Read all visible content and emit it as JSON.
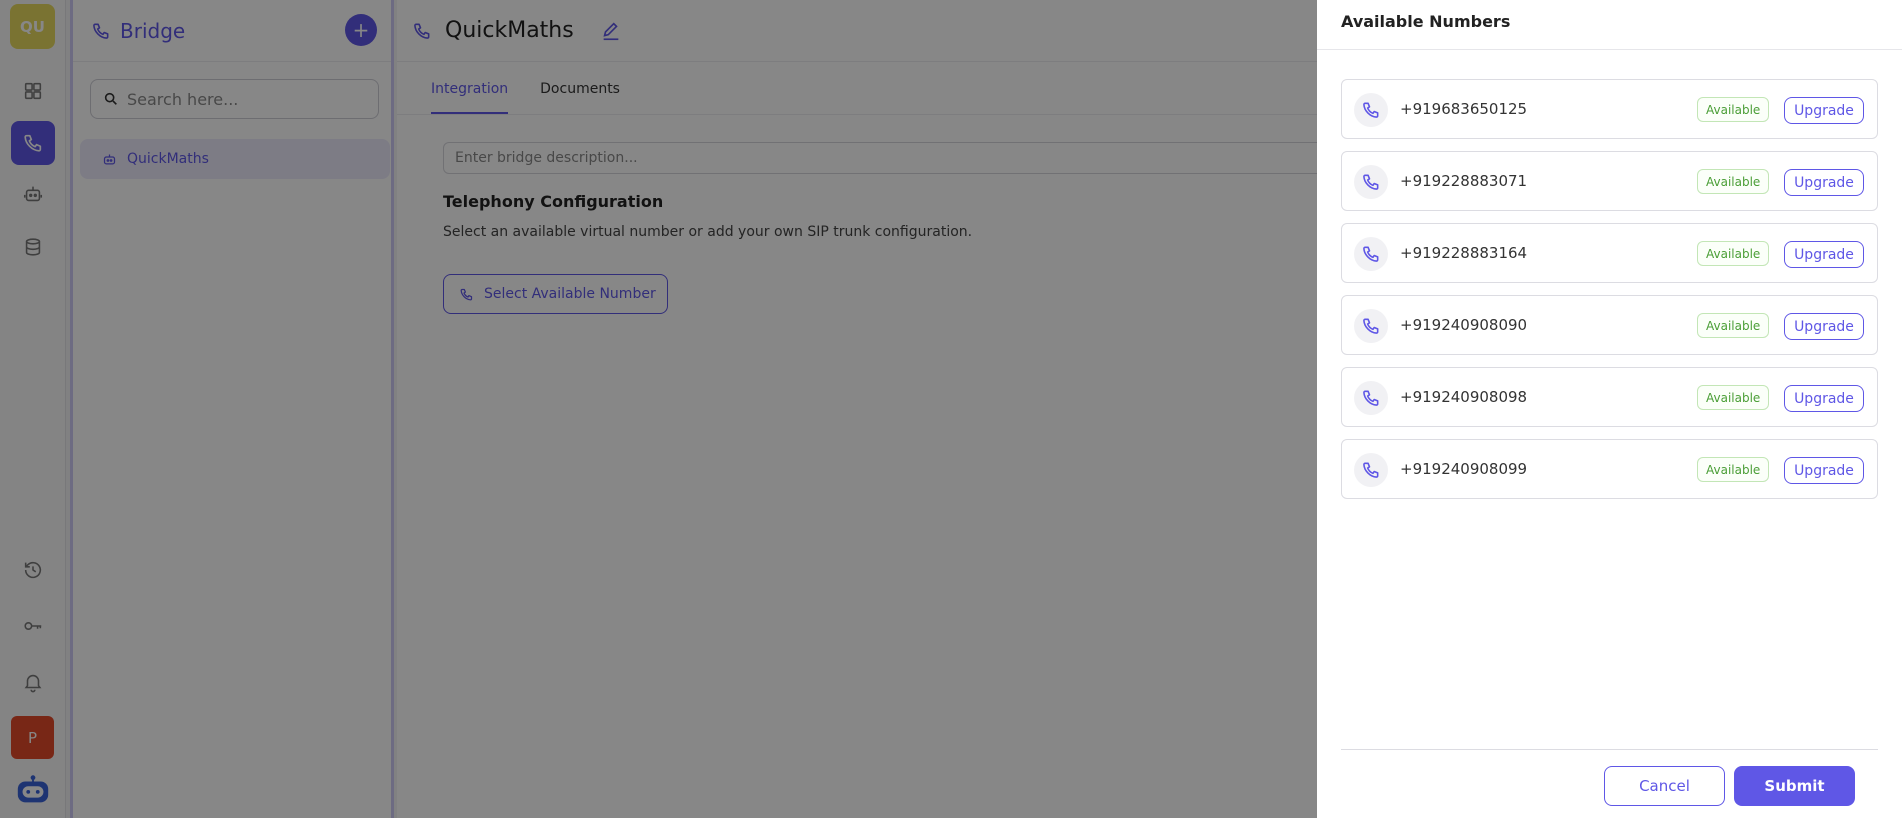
{
  "rail": {
    "workspace_initials": "QU",
    "items": [
      {
        "icon": "dashboard-icon"
      },
      {
        "icon": "phone-icon",
        "active": true
      },
      {
        "icon": "bot-icon"
      },
      {
        "icon": "database-icon"
      },
      {
        "icon": "history-icon"
      },
      {
        "icon": "key-icon"
      },
      {
        "icon": "bell-icon"
      }
    ],
    "avatar_initial": "P"
  },
  "bridge_panel": {
    "title": "Bridge",
    "search_placeholder": "Search here...",
    "items": [
      {
        "label": "QuickMaths"
      }
    ]
  },
  "main": {
    "title": "QuickMaths",
    "tabs": [
      {
        "label": "Integration",
        "active": true
      },
      {
        "label": "Documents"
      }
    ],
    "description_placeholder": "Enter bridge description...",
    "telephony_title": "Telephony Configuration",
    "telephony_subtitle": "Select an available virtual number or add your own SIP trunk configuration.",
    "select_button_label": "Select Available Number"
  },
  "drawer": {
    "title": "Available Numbers",
    "numbers": [
      {
        "number": "+919683650125",
        "status": "Available",
        "action": "Upgrade"
      },
      {
        "number": "+919228883071",
        "status": "Available",
        "action": "Upgrade"
      },
      {
        "number": "+919228883164",
        "status": "Available",
        "action": "Upgrade"
      },
      {
        "number": "+919240908090",
        "status": "Available",
        "action": "Upgrade"
      },
      {
        "number": "+919240908098",
        "status": "Available",
        "action": "Upgrade"
      },
      {
        "number": "+919240908099",
        "status": "Available",
        "action": "Upgrade"
      }
    ],
    "cancel_label": "Cancel",
    "submit_label": "Submit"
  },
  "colors": {
    "accent": "#5f57e6",
    "available": "#4a9e36",
    "workspace": "#e7d95f",
    "avatar": "#e24a2a"
  }
}
